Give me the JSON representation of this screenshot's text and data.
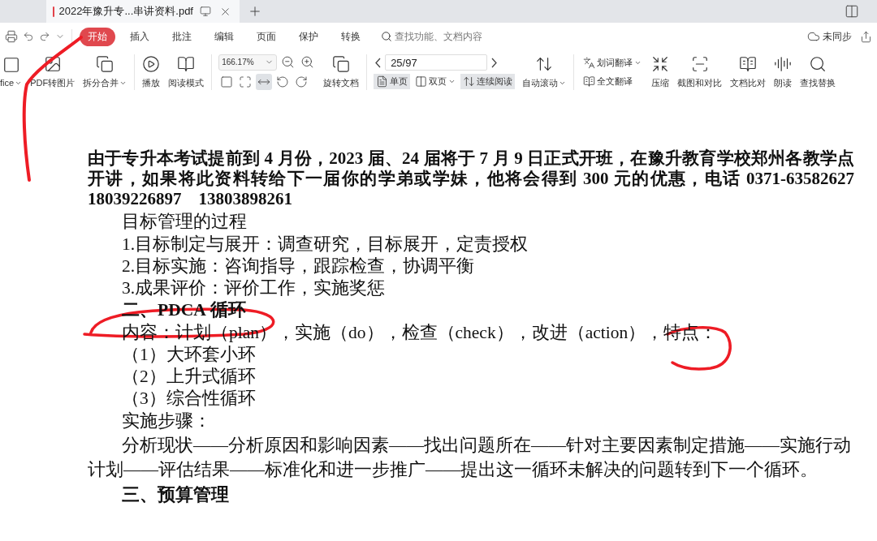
{
  "tab": {
    "title": "2022年豫升专...串讲资料.pdf"
  },
  "menu": [
    {
      "label": "开始",
      "selected": true
    },
    {
      "label": "插入",
      "selected": false
    },
    {
      "label": "批注",
      "selected": false
    },
    {
      "label": "编辑",
      "selected": false
    },
    {
      "label": "页面",
      "selected": false
    },
    {
      "label": "保护",
      "selected": false
    },
    {
      "label": "转换",
      "selected": false
    }
  ],
  "search": {
    "placeholder": "查找功能、文档内容"
  },
  "sync": {
    "label": "未同步"
  },
  "toolbar": {
    "file_tools": [
      {
        "label": "fice",
        "dropdown": true
      },
      {
        "label": "PDF转图片",
        "dropdown": false
      },
      {
        "label": "拆分合并",
        "dropdown": true
      }
    ],
    "view_tools": [
      {
        "label": "播放"
      },
      {
        "label": "阅读模式"
      }
    ],
    "zoom": {
      "value": "166.17%"
    },
    "fit_buttons": [
      {
        "selected": false
      },
      {
        "selected": false
      },
      {
        "selected": true
      },
      {
        "selected": false
      },
      {
        "selected": false
      }
    ],
    "rotate": {
      "label": "旋转文档"
    },
    "page": {
      "value": "25/97"
    },
    "layouts": [
      {
        "label": "单页",
        "selected": true,
        "dropdown": false
      },
      {
        "label": "双页",
        "selected": false,
        "dropdown": true
      },
      {
        "label": "连续阅读",
        "selected": true,
        "dropdown": false
      }
    ],
    "auto_scroll": {
      "label": "自动滚动",
      "dropdown": true
    },
    "translate": [
      {
        "label": "划词翻译",
        "dropdown": true
      },
      {
        "label": "全文翻译",
        "dropdown": false
      }
    ],
    "tools": [
      {
        "label": "压缩"
      },
      {
        "label": "截图和对比"
      },
      {
        "label": "文档比对"
      },
      {
        "label": "朗读"
      },
      {
        "label": "查找替换"
      }
    ]
  },
  "document": {
    "notice": "由于专升本考试提前到 4 月份，2023 届、24 届将于 7 月 9 日正式开班，在豫升教育学校郑州各教学点开讲，如果将此资料转给下一届你的学弟或学妹，他将会得到 300 元的优惠，电话 0371-63582627　18039226897　13803898261",
    "lines": [
      {
        "kind": "body",
        "text": "目标管理的过程"
      },
      {
        "kind": "body",
        "text": "1.目标制定与展开：调查研究，目标展开，定责授权"
      },
      {
        "kind": "body",
        "text": "2.目标实施：咨询指导，跟踪检查，协调平衡"
      },
      {
        "kind": "body",
        "text": "3.成果评价：评价工作，实施奖惩"
      },
      {
        "kind": "heading",
        "text": "二、**PDCA** 循环"
      },
      {
        "kind": "body",
        "text": "内容：计划（plan），实施（do），检查（check），改进（action），特点："
      },
      {
        "kind": "item",
        "text": "（1）大环套小环"
      },
      {
        "kind": "item",
        "text": "（2）上升式循环"
      },
      {
        "kind": "item",
        "text": "（3）综合性循环"
      },
      {
        "kind": "body",
        "text": "实施步骤："
      },
      {
        "kind": "paragraph",
        "text": "分析现状——分析原因和影响因素——找出问题所在——针对主要因素制定措施——实施行动计划——评估结果——标准化和进一步推广——提出这一循环未解决的问题转到下一个循环。"
      },
      {
        "kind": "heading",
        "text": "三、预算管理"
      }
    ]
  }
}
